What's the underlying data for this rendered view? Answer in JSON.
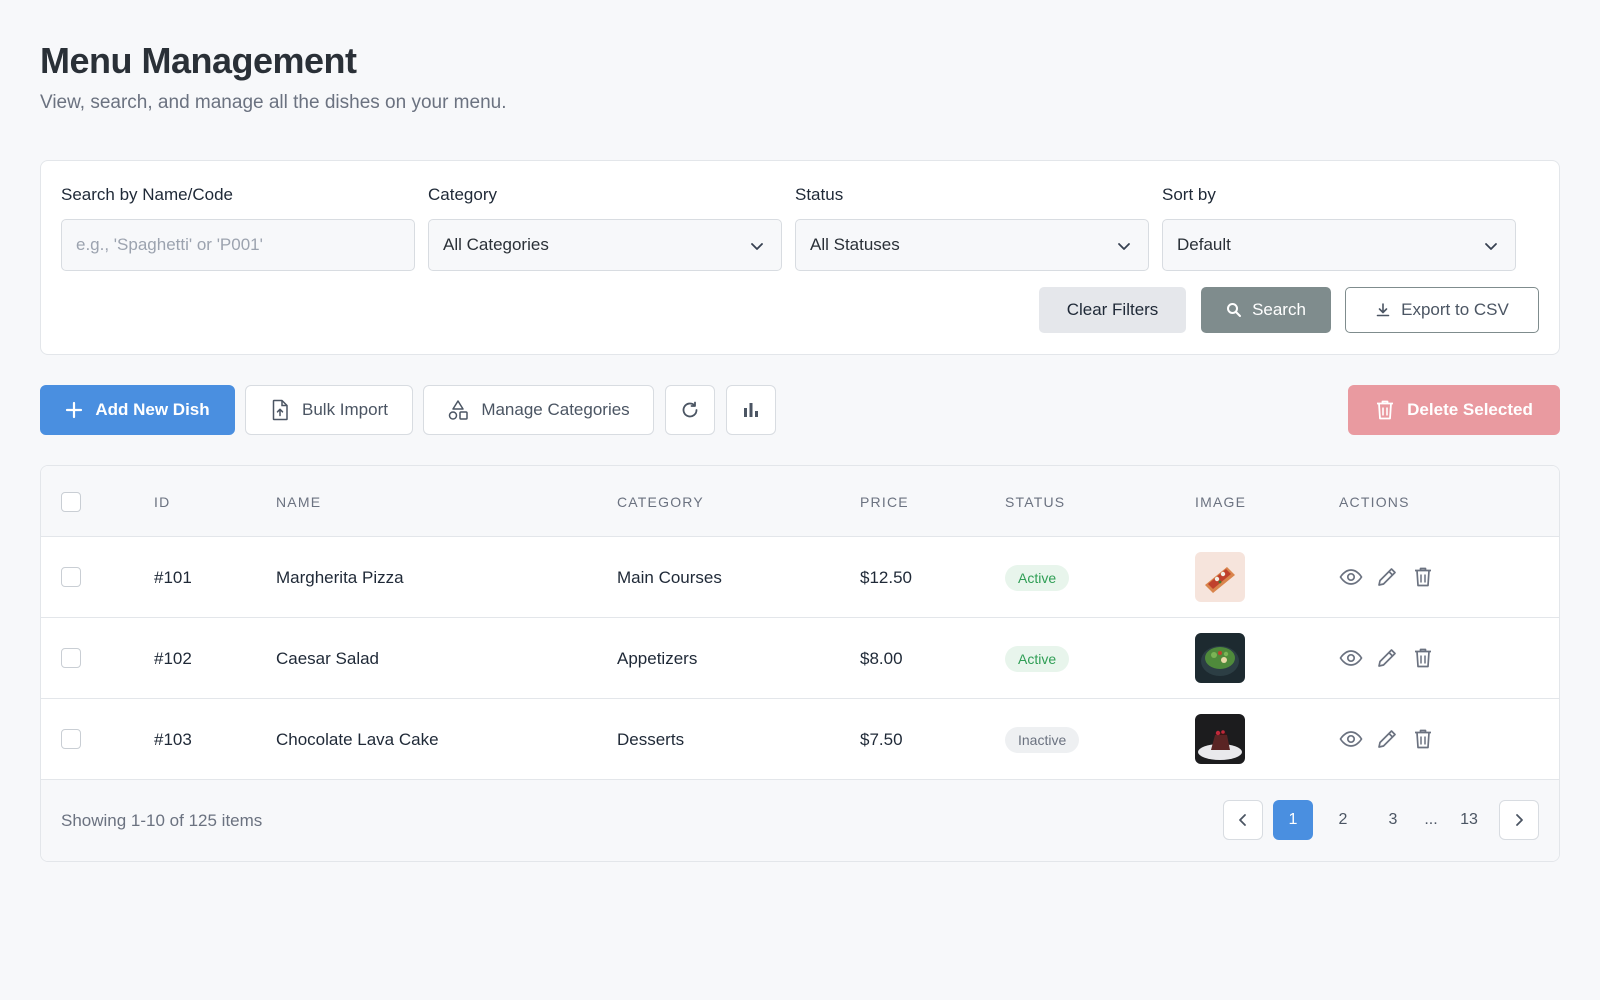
{
  "header": {
    "title": "Menu Management",
    "subtitle": "View, search, and manage all the dishes on your menu."
  },
  "filters": {
    "search_label": "Search by Name/Code",
    "search_placeholder": "e.g., 'Spaghetti' or 'P001'",
    "category_label": "Category",
    "category_value": "All Categories",
    "status_label": "Status",
    "status_value": "All Statuses",
    "sort_label": "Sort by",
    "sort_value": "Default",
    "clear_label": "Clear Filters",
    "search_button": "Search",
    "export_label": "Export to CSV"
  },
  "toolbar": {
    "add_label": "Add New Dish",
    "bulk_label": "Bulk Import",
    "categories_label": "Manage Categories",
    "delete_label": "Delete Selected",
    "refresh_icon": "refresh-icon",
    "stats_icon": "bar-chart-icon"
  },
  "table": {
    "columns": [
      "ID",
      "NAME",
      "CATEGORY",
      "PRICE",
      "STATUS",
      "IMAGE",
      "ACTIONS"
    ],
    "rows": [
      {
        "id": "#101",
        "name": "Margherita Pizza",
        "category": "Main Courses",
        "price": "$12.50",
        "status": "Active",
        "image": "pizza-thumbnail"
      },
      {
        "id": "#102",
        "name": "Caesar Salad",
        "category": "Appetizers",
        "price": "$8.00",
        "status": "Active",
        "image": "salad-thumbnail"
      },
      {
        "id": "#103",
        "name": "Chocolate Lava Cake",
        "category": "Desserts",
        "price": "$7.50",
        "status": "Inactive",
        "image": "cake-thumbnail"
      }
    ]
  },
  "footer": {
    "showing": "Showing 1-10 of 125 items",
    "pages": [
      "1",
      "2",
      "3",
      "...",
      "13"
    ],
    "current_page": "1"
  },
  "colors": {
    "primary": "#4a8fe0",
    "danger_disabled": "#e99aa0",
    "search_button": "#7f8c8d",
    "active_badge": "#2f9e55"
  }
}
